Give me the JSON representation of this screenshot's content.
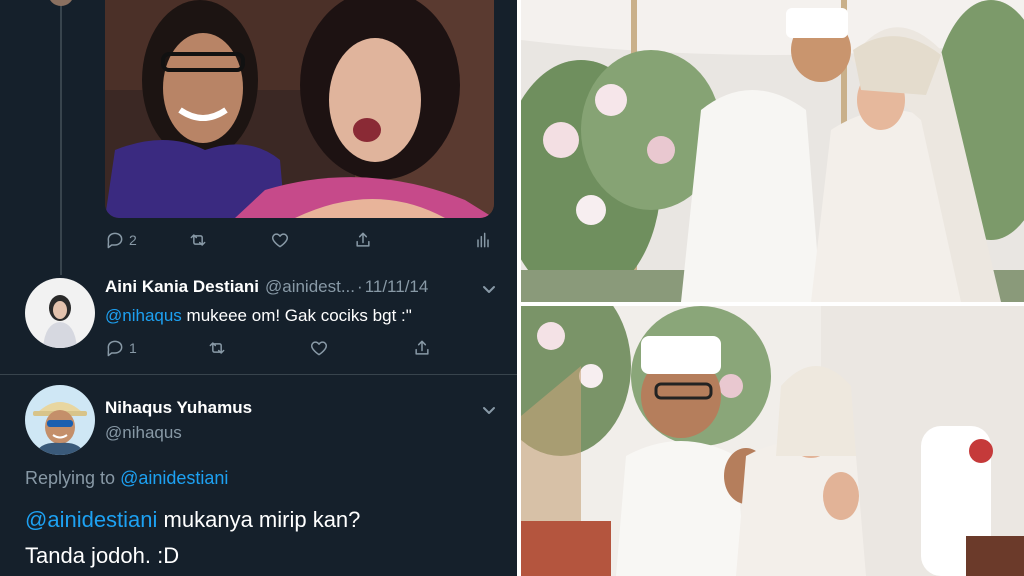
{
  "thread": {
    "top_tweet": {
      "reply_count": "2",
      "icons": [
        "reply-icon",
        "retweet-icon",
        "like-icon",
        "share-icon",
        "analytics-icon"
      ]
    },
    "reply_1": {
      "display_name": "Aini Kania Destiani",
      "handle": "@ainidest...",
      "separator": "·",
      "date": "11/11/14",
      "mention": "@nihaqus",
      "text": " mukeee om! Gak cociks bgt :\"",
      "reply_count": "1"
    },
    "reply_2": {
      "display_name": "Nihaqus Yuhamus",
      "handle": "@nihaqus",
      "replying_prefix": "Replying to ",
      "replying_handle": "@ainidestiani",
      "mention": "@ainidestiani",
      "line1_text": " mukanya mirip kan?",
      "line2_text": "Tanda jodoh. :D"
    }
  },
  "colors": {
    "background": "#15202b",
    "mention": "#1da1f2",
    "muted": "#8899a6",
    "divider": "#38444d"
  }
}
